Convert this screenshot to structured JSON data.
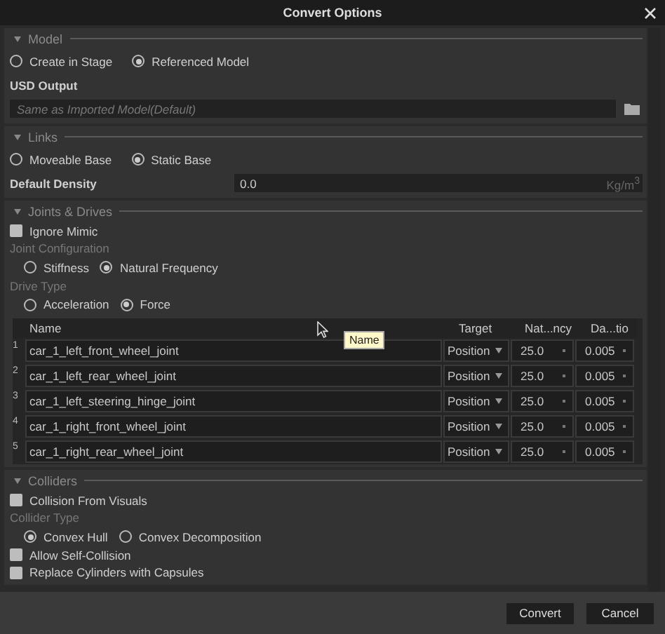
{
  "window": {
    "title": "Convert Options"
  },
  "model": {
    "header": "Model",
    "options": [
      {
        "label": "Create in Stage",
        "selected": false
      },
      {
        "label": "Referenced Model",
        "selected": true
      }
    ],
    "usd_output": {
      "label": "USD Output",
      "placeholder": "Same as Imported Model(Default)"
    }
  },
  "links": {
    "header": "Links",
    "options": [
      {
        "label": "Moveable Base",
        "selected": false
      },
      {
        "label": "Static Base",
        "selected": true
      }
    ],
    "default_density": {
      "label": "Default Density",
      "value": "0.0",
      "unit": "Kg/m$^{3}$"
    }
  },
  "joints": {
    "header": "Joints & Drives",
    "ignore_mimic": {
      "label": "Ignore Mimic",
      "checked": false
    },
    "joint_configuration": {
      "label": "Joint Configuration",
      "options": [
        {
          "label": "Stiffness",
          "selected": false
        },
        {
          "label": "Natural Frequency",
          "selected": true
        }
      ]
    },
    "drive_type": {
      "label": "Drive Type",
      "options": [
        {
          "label": "Acceleration",
          "selected": false
        },
        {
          "label": "Force",
          "selected": true
        }
      ]
    },
    "table": {
      "columns": [
        "Name",
        "Target",
        "Nat...ncy",
        "Da...tio"
      ],
      "rows": [
        {
          "index": "1",
          "name": "car_1_left_front_wheel_joint",
          "target": "Position",
          "natural_frequency": "25.0",
          "damping": "0.005"
        },
        {
          "index": "2",
          "name": "car_1_left_rear_wheel_joint",
          "target": "Position",
          "natural_frequency": "25.0",
          "damping": "0.005"
        },
        {
          "index": "3",
          "name": "car_1_left_steering_hinge_joint",
          "target": "Position",
          "natural_frequency": "25.0",
          "damping": "0.005"
        },
        {
          "index": "4",
          "name": "car_1_right_front_wheel_joint",
          "target": "Position",
          "natural_frequency": "25.0",
          "damping": "0.005"
        },
        {
          "index": "5",
          "name": "car_1_right_rear_wheel_joint",
          "target": "Position",
          "natural_frequency": "25.0",
          "damping": "0.005"
        }
      ]
    },
    "tooltip": "Name"
  },
  "colliders": {
    "header": "Colliders",
    "collision_from_visuals": {
      "label": "Collision From Visuals",
      "checked": false
    },
    "collider_type": {
      "label": "Collider Type",
      "options": [
        {
          "label": "Convex Hull",
          "selected": true
        },
        {
          "label": "Convex Decomposition",
          "selected": false
        }
      ]
    },
    "allow_self_collision": {
      "label": "Allow Self-Collision",
      "checked": false
    },
    "replace_cylinders": {
      "label": "Replace Cylinders with Capsules",
      "checked": false
    }
  },
  "buttons": [
    "Convert",
    "Cancel"
  ]
}
